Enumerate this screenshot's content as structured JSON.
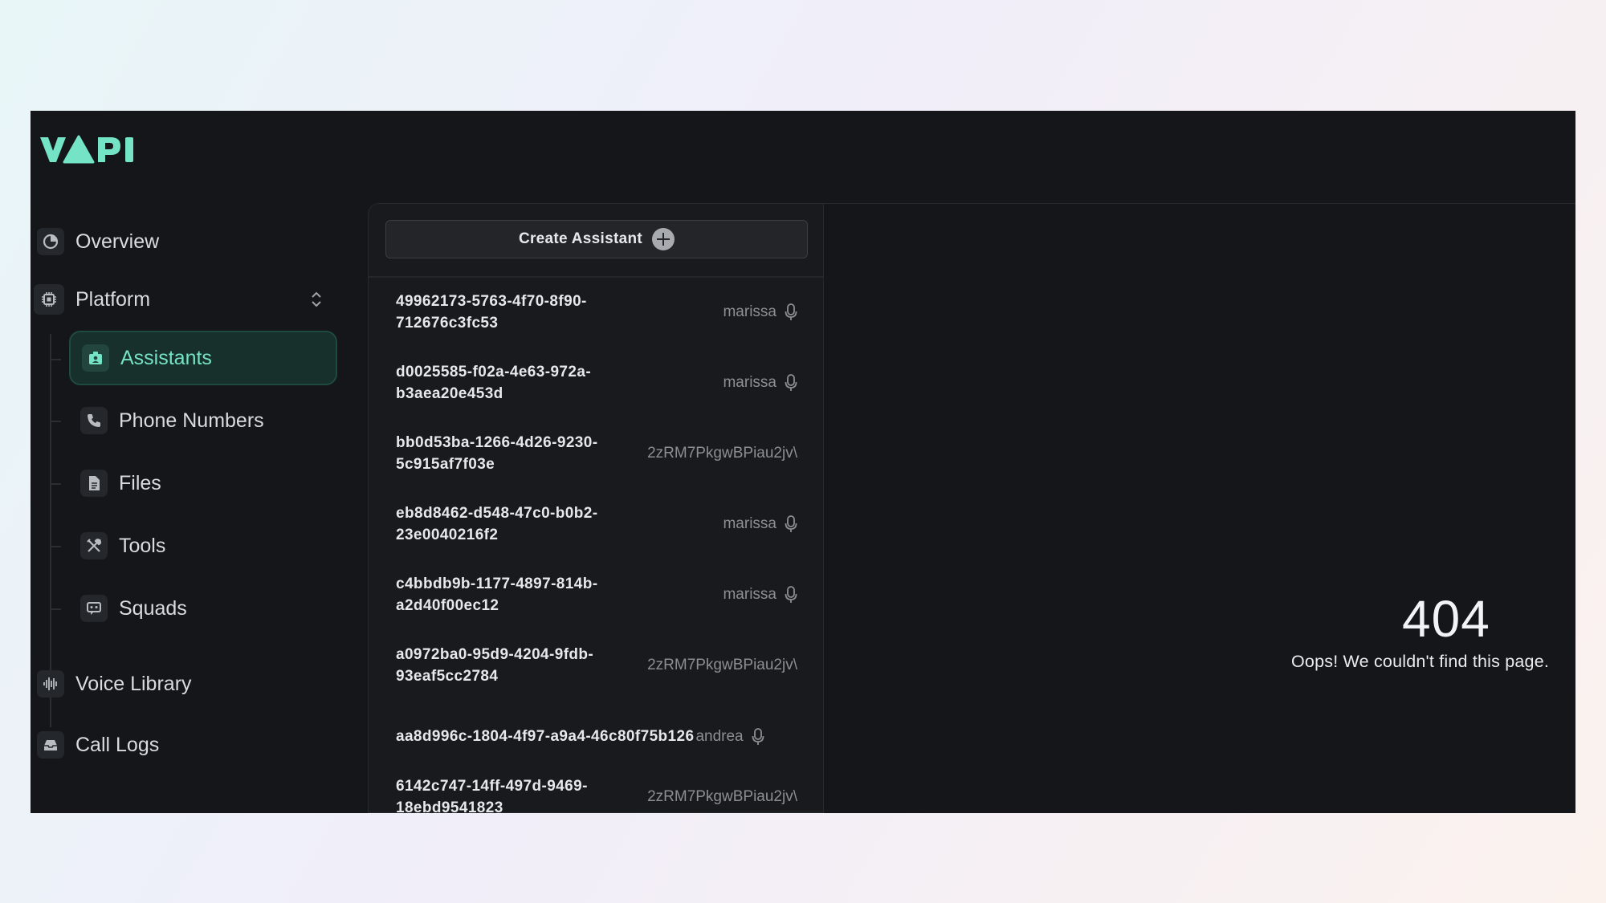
{
  "brand": {
    "logo_text": "VAPI",
    "accent": "#74e3c6"
  },
  "sidebar": {
    "overview": {
      "label": "Overview",
      "icon": "pie-chart-icon"
    },
    "platform": {
      "label": "Platform",
      "icon": "chip-icon"
    },
    "sub_items": [
      {
        "label": "Assistants",
        "icon": "assistant-icon",
        "active": true
      },
      {
        "label": "Phone Numbers",
        "icon": "phone-icon"
      },
      {
        "label": "Files",
        "icon": "file-icon"
      },
      {
        "label": "Tools",
        "icon": "tools-icon"
      },
      {
        "label": "Squads",
        "icon": "squads-icon"
      }
    ],
    "voice_library": {
      "label": "Voice Library",
      "icon": "waveform-icon"
    },
    "call_logs": {
      "label": "Call Logs",
      "icon": "inbox-icon"
    }
  },
  "assistants_panel": {
    "create_label": "Create Assistant",
    "rows": [
      {
        "id": "49962173-5763-4f70-8f90-712676c3fc53",
        "voice": "marissa",
        "mic": true
      },
      {
        "id": "d0025585-f02a-4e63-972a-b3aea20e453d",
        "voice": "marissa",
        "mic": true
      },
      {
        "id": "bb0d53ba-1266-4d26-9230-5c915af7f03e",
        "voice": "2zRM7PkgwBPiau2jv\\",
        "mic": false
      },
      {
        "id": "eb8d8462-d548-47c0-b0b2-23e0040216f2",
        "voice": "marissa",
        "mic": true
      },
      {
        "id": "c4bbdb9b-1177-4897-814b-a2d40f00ec12",
        "voice": "marissa",
        "mic": true
      },
      {
        "id": "a0972ba0-95d9-4204-9fdb-93eaf5cc2784",
        "voice": "2zRM7PkgwBPiau2jv\\",
        "mic": false
      },
      {
        "id": "aa8d996c-1804-4f97-a9a4-46c80f75b126",
        "voice": "andrea",
        "mic": true
      },
      {
        "id": "6142c747-14ff-497d-9469-18ebd9541823",
        "voice": "2zRM7PkgwBPiau2jv\\",
        "mic": false
      }
    ]
  },
  "error": {
    "code": "404",
    "message": "Oops! We couldn't find this page."
  }
}
